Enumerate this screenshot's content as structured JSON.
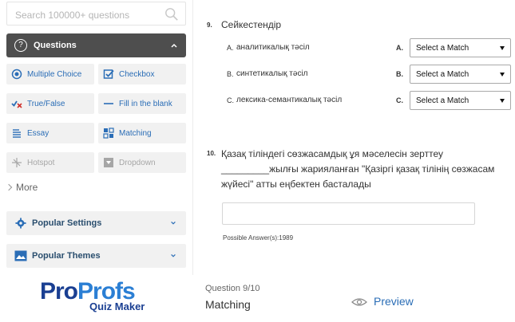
{
  "search": {
    "placeholder": "Search 100000+ questions"
  },
  "questions_panel": {
    "title": "Questions"
  },
  "question_types": [
    {
      "label": "Multiple Choice",
      "icon": "radio-icon"
    },
    {
      "label": "Checkbox",
      "icon": "checkbox-icon"
    },
    {
      "label": "True/False",
      "icon": "check-x-icon"
    },
    {
      "label": "Fill in the blank",
      "icon": "dash-icon"
    },
    {
      "label": "Essay",
      "icon": "essay-icon"
    },
    {
      "label": "Matching",
      "icon": "matching-icon"
    },
    {
      "label": "Hotspot",
      "icon": "hotspot-icon"
    },
    {
      "label": "Dropdown",
      "icon": "dropdown-icon"
    }
  ],
  "more_label": "More",
  "popular_settings": {
    "label": "Popular Settings"
  },
  "popular_themes": {
    "label": "Popular Themes"
  },
  "question9": {
    "number": "9.",
    "text": "Сейкестендір",
    "rows": [
      {
        "prefix": "A.",
        "item": "аналитикалық тәсіл",
        "letter": "A.",
        "select": "Select a Match"
      },
      {
        "prefix": "B.",
        "item": "синтетикалық тәсіл",
        "letter": "B.",
        "select": "Select a Match"
      },
      {
        "prefix": "C.",
        "item": "лексика-семантикалық тәсіл",
        "letter": "C.",
        "select": "Select a Match"
      }
    ]
  },
  "question10": {
    "number": "10.",
    "text": "Қазақ тіліндегі сөзжасамдық ұя мәселесін зерттеу _________жылғы жарияланған \"Қазіргі қазақ тілінің сөзжасам жүйесі\" атты еңбектен басталады",
    "possible_answer": "Possible Answer(s):1989"
  },
  "footer": {
    "logo_part1": "Pro",
    "logo_part2": "Profs",
    "logo_sub": "Quiz Maker",
    "question_counter": "Question 9/10",
    "question_type": "Matching",
    "preview_label": "Preview"
  },
  "colors": {
    "accent": "#2a6db6",
    "header_dark": "#4e4e4e",
    "tile_bg": "#f1f1f1",
    "logo_dark": "#1a3f92"
  }
}
